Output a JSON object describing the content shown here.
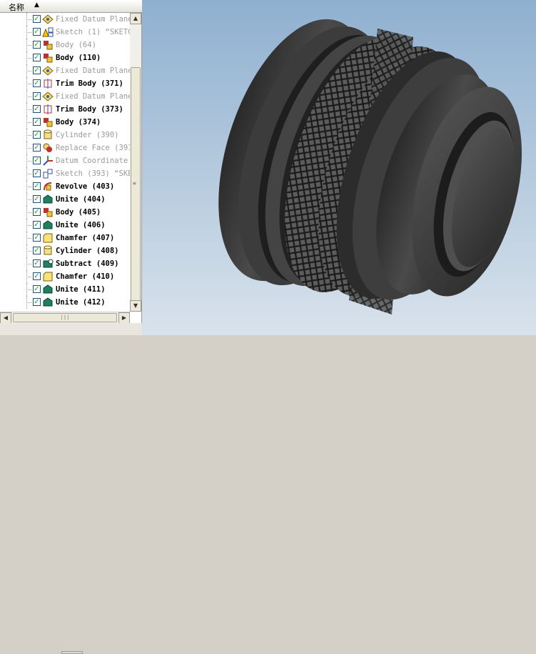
{
  "tree": {
    "column_header": "名称",
    "rows": [
      {
        "label": "Fixed Datum Plane",
        "icon": "datum-plane-icon",
        "dim": true
      },
      {
        "label": "Sketch (1) “SKETC",
        "icon": "sketch-warning-icon",
        "dim": true
      },
      {
        "label": "Body (64)",
        "icon": "body-icon",
        "dim": true
      },
      {
        "label": "Body (110)",
        "icon": "body-icon",
        "dim": false
      },
      {
        "label": "Fixed Datum Plane",
        "icon": "datum-plane-icon",
        "dim": true
      },
      {
        "label": "Trim Body (371)",
        "icon": "trim-body-icon",
        "dim": false
      },
      {
        "label": "Fixed Datum Plane",
        "icon": "datum-plane-icon",
        "dim": true
      },
      {
        "label": "Trim Body (373)",
        "icon": "trim-body-icon",
        "dim": false
      },
      {
        "label": "Body (374)",
        "icon": "body-icon",
        "dim": false
      },
      {
        "label": "Cylinder (390)",
        "icon": "cylinder-icon",
        "dim": true
      },
      {
        "label": "Replace Face (391",
        "icon": "replace-face-icon",
        "dim": true
      },
      {
        "label": "Datum Coordinate",
        "icon": "datum-coordinate-icon",
        "dim": true
      },
      {
        "label": "Sketch (393) “SKE",
        "icon": "sketch-icon",
        "dim": true
      },
      {
        "label": "Revolve (403)",
        "icon": "revolve-icon",
        "dim": false
      },
      {
        "label": "Unite (404)",
        "icon": "unite-icon",
        "dim": false
      },
      {
        "label": "Body (405)",
        "icon": "body-icon",
        "dim": false
      },
      {
        "label": "Unite (406)",
        "icon": "unite-icon",
        "dim": false
      },
      {
        "label": "Chamfer (407)",
        "icon": "chamfer-icon",
        "dim": false
      },
      {
        "label": "Cylinder (408)",
        "icon": "cylinder-icon",
        "dim": false
      },
      {
        "label": "Subtract (409)",
        "icon": "subtract-icon",
        "dim": false
      },
      {
        "label": "Chamfer (410)",
        "icon": "chamfer-icon",
        "dim": false
      },
      {
        "label": "Unite (411)",
        "icon": "unite-icon",
        "dim": false
      },
      {
        "label": "Unite (412)",
        "icon": "unite-icon",
        "dim": false
      }
    ]
  },
  "colors": {
    "model_base": "#3a3a3a",
    "model_highlight": "#6a6a6a",
    "model_shadow": "#151515",
    "check_green": "#21a121"
  }
}
